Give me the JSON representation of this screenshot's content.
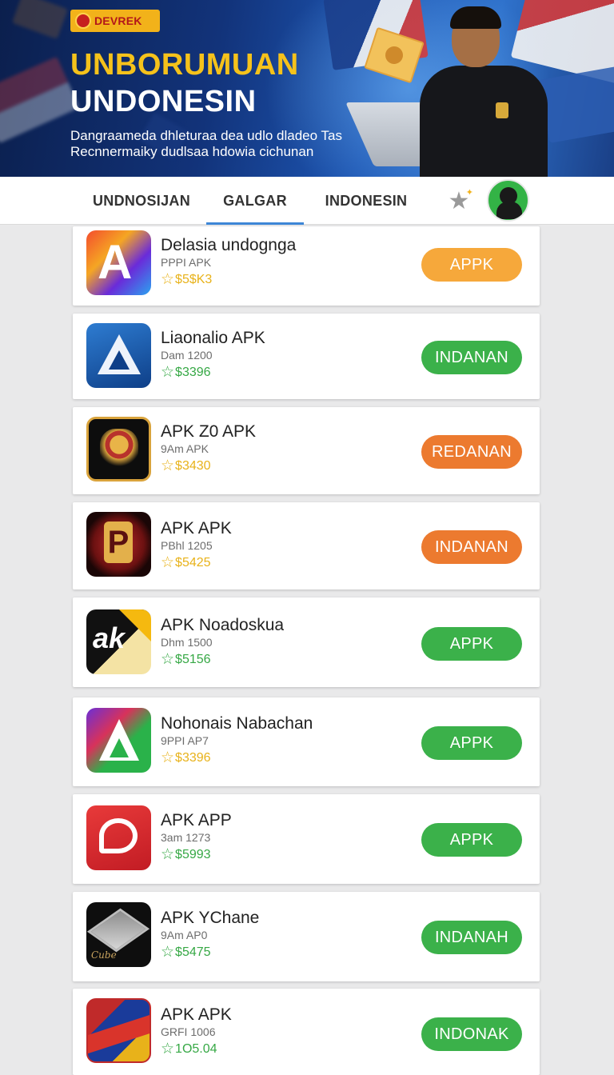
{
  "banner": {
    "logo_text": "DEVREK",
    "headline_1": "UNBORUMUAN",
    "headline_2": "UNDONESIN",
    "subline_1": "Dangraameda dhleturaa dea udlo dladeo Tas",
    "subline_2": "Recnnermaiky dudlsaa hdowia cichunan"
  },
  "tabs": [
    {
      "label": "UNDNOSIJAN",
      "active": false
    },
    {
      "label": "GALGAR",
      "active": true
    },
    {
      "label": "INDONESIN",
      "active": false
    }
  ],
  "toolbar": {
    "star_icon": "star-icon",
    "avatar_icon": "user-avatar"
  },
  "colors": {
    "accent_blue": "#3d86d6",
    "button_orange": "#f6a83b",
    "button_green": "#3bb14a",
    "button_dark_orange": "#ec7a2f",
    "rating_gold": "#e8b21a",
    "rating_green": "#36a845"
  },
  "apps": [
    {
      "name": "Delasia undogngа",
      "meta": "PPPI APK",
      "rating": "$5$K3",
      "rating_color": "gold",
      "button": "APPK",
      "button_color": "orange",
      "icon": "gradient-a-icon"
    },
    {
      "name": "Liaonalio APK",
      "meta": "Dam 1200",
      "rating": "$3396",
      "rating_color": "green",
      "button": "INDANAN",
      "button_color": "green",
      "icon": "blue-triangle-icon"
    },
    {
      "name": "APK Z0 APK",
      "meta": "9Am APK",
      "rating": "$3430",
      "rating_color": "gold",
      "button": "REDANAN",
      "button_color": "dark_orange",
      "icon": "garuda-emblem-icon"
    },
    {
      "name": "APK APK",
      "meta": "PBhl 1205",
      "rating": "$5425",
      "rating_color": "gold",
      "button": "INDANAN",
      "button_color": "dark_orange",
      "icon": "p-shield-icon"
    },
    {
      "name": "APK Noadoskua",
      "meta": "Dhm 1500",
      "rating": "$5156",
      "rating_color": "green",
      "button": "APPK",
      "button_color": "green",
      "icon": "ak-fold-icon"
    },
    {
      "name": "Nohonais Nabachan",
      "meta": "9PPI AP7",
      "rating": "$3396",
      "rating_color": "gold",
      "button": "APPK",
      "button_color": "green",
      "icon": "multicolor-triangle-icon"
    },
    {
      "name": "APK APP",
      "meta": "3am 1273",
      "rating": "$5993",
      "rating_color": "green",
      "button": "APPK",
      "button_color": "green",
      "icon": "chat-bubble-icon"
    },
    {
      "name": "APK YChane",
      "meta": "9Am AP0",
      "rating": "$5475",
      "rating_color": "green",
      "button": "INDANAH",
      "button_color": "green",
      "icon": "cube-icon"
    },
    {
      "name": "APK APK",
      "meta": "GRFI 1006",
      "rating": "1O5.04",
      "rating_color": "green",
      "button": "INDONAK",
      "button_color": "green",
      "icon": "flag-badge-icon"
    }
  ]
}
